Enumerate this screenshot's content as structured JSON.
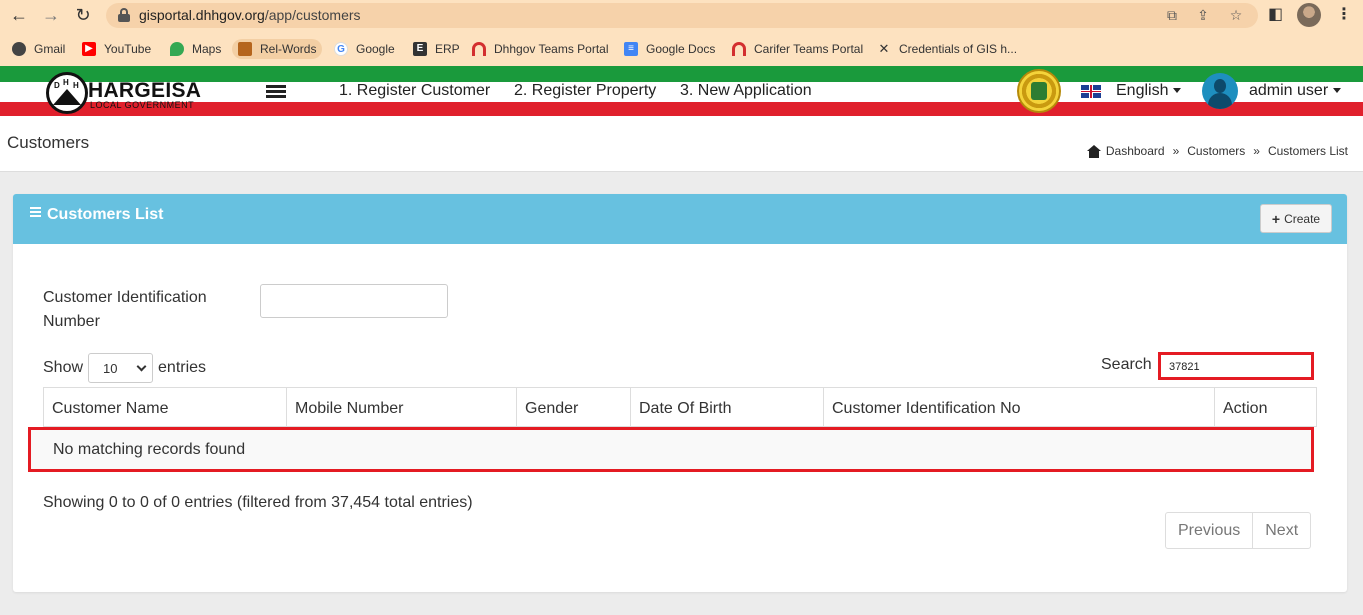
{
  "browser": {
    "url_host": "gisportal.dhhgov.org",
    "url_path": "/app/customers",
    "bookmarks": [
      {
        "label": "Gmail",
        "icon": "gmail-icon"
      },
      {
        "label": "YouTube",
        "icon": "youtube-icon"
      },
      {
        "label": "Maps",
        "icon": "maps-icon"
      },
      {
        "label": "Rel-Words",
        "icon": "rel-words-icon"
      },
      {
        "label": "Google",
        "icon": "google-icon"
      },
      {
        "label": "ERP",
        "icon": "erp-icon"
      },
      {
        "label": "Dhhgov Teams Portal",
        "icon": "teams-portal-icon"
      },
      {
        "label": "Google Docs",
        "icon": "docs-icon"
      },
      {
        "label": "Carifer Teams Portal",
        "icon": "teams-portal-icon"
      },
      {
        "label": "Credentials of GIS h...",
        "icon": "tools-icon"
      }
    ]
  },
  "header": {
    "logo_title": "HARGEISA",
    "logo_subtitle": "LOCAL GOVERNMENT",
    "logo_letters": [
      "D",
      "H",
      "H"
    ],
    "nav": [
      "1. Register Customer",
      "2. Register Property",
      "3. New Application"
    ],
    "language": "English",
    "user": "admin user"
  },
  "page": {
    "title": "Customers",
    "breadcrumb": [
      "Dashboard",
      "Customers",
      "Customers List"
    ],
    "breadcrumb_sep": "»"
  },
  "card": {
    "title": "Customers List",
    "create_label": "Create",
    "filter_label": "Customer Identification Number",
    "show_label": "Show",
    "entries_label": "entries",
    "page_size": "10",
    "search_label": "Search",
    "search_value": "37821",
    "columns": [
      "Customer Name",
      "Mobile Number",
      "Gender",
      "Date Of Birth",
      "Customer Identification No",
      "Action"
    ],
    "empty_message": "No matching records found",
    "info": "Showing 0 to 0 of 0 entries (filtered from 37,454 total entries)",
    "prev_label": "Previous",
    "next_label": "Next"
  },
  "colors": {
    "card_header": "#67c1e0",
    "highlight": "#e41b23",
    "stripe_green": "#1a9a3c",
    "stripe_red": "#e0202c"
  }
}
